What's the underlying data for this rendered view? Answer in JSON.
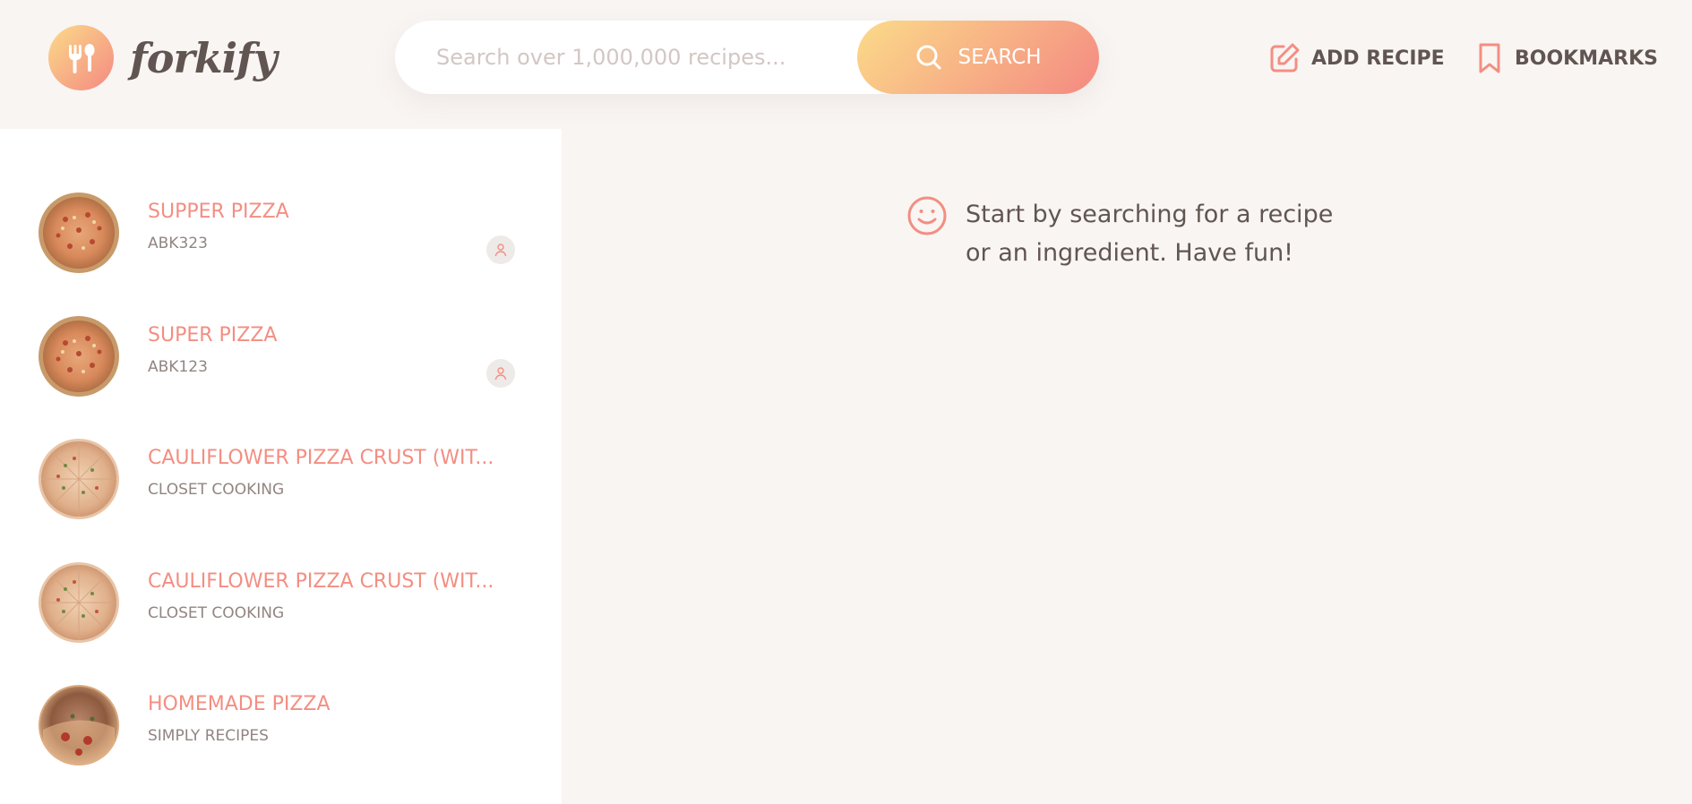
{
  "app": {
    "logo_text": "forkify",
    "logo_icon": "fork-spoon-icon"
  },
  "search": {
    "placeholder": "Search over 1,000,000 recipes...",
    "value": "",
    "button_label": "SEARCH",
    "button_icon": "search-icon"
  },
  "nav": {
    "add_recipe_label": "ADD RECIPE",
    "add_recipe_icon": "edit-icon",
    "bookmarks_label": "BOOKMARKS",
    "bookmarks_icon": "bookmark-icon"
  },
  "results": [
    {
      "title": "SUPPER PIZZA",
      "publisher": "ABK323",
      "user_generated": true,
      "image": "pizza-icon"
    },
    {
      "title": "SUPER PIZZA",
      "publisher": "ABK123",
      "user_generated": true,
      "image": "pizza-icon"
    },
    {
      "title": "CAULIFLOWER PIZZA CRUST (WIT...",
      "publisher": "CLOSET COOKING",
      "user_generated": false,
      "image": "pizza-icon"
    },
    {
      "title": "CAULIFLOWER PIZZA CRUST (WIT...",
      "publisher": "CLOSET COOKING",
      "user_generated": false,
      "image": "pizza-icon"
    },
    {
      "title": "HOMEMADE PIZZA",
      "publisher": "SIMPLY RECIPES",
      "user_generated": false,
      "image": "pizza-icon"
    }
  ],
  "message": {
    "icon": "smile-icon",
    "text": "Start by searching for a recipe or an ingredient. Have fun!"
  },
  "colors": {
    "accent": "#f38e82",
    "gradient_start": "#fbdb89",
    "gradient_end": "#f48982",
    "text": "#615551",
    "background": "#f9f5f3"
  }
}
